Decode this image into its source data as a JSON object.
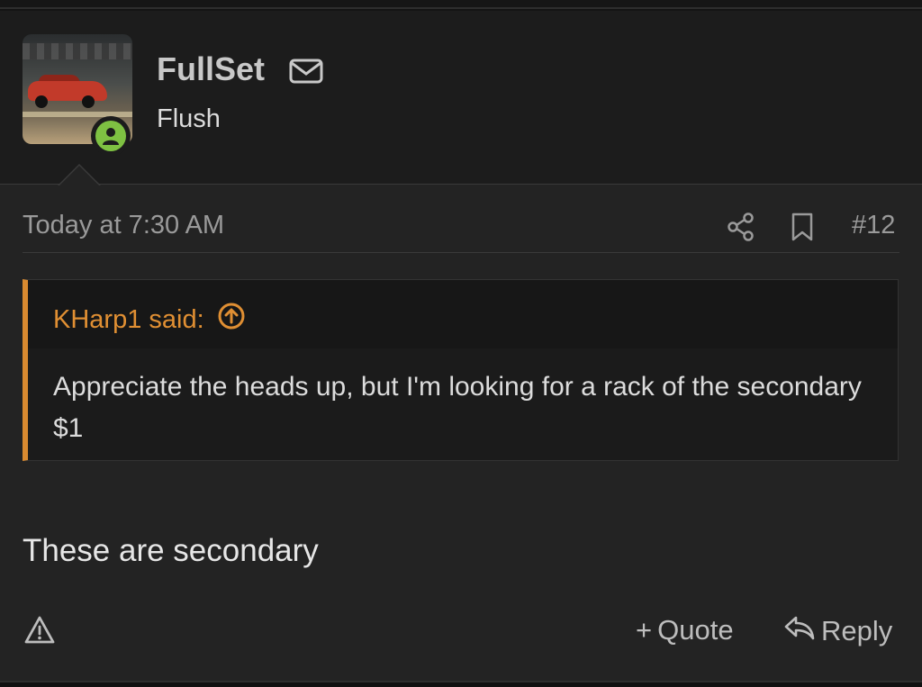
{
  "post": {
    "author": {
      "username": "FullSet",
      "user_title": "Flush",
      "avatar_icon": "avatar-race-car-image",
      "online_status_icon": "user-online-icon",
      "message_icon": "envelope-icon"
    },
    "date": "Today at 7:30 AM",
    "post_number": "#12",
    "quote": {
      "attribution": "KHarp1 said:",
      "text": "Appreciate the heads up, but I'm looking for a rack of the secondary $1"
    },
    "message": "These are secondary",
    "actions": {
      "quote_label": "Quote",
      "quote_prefix": "+",
      "reply_label": "Reply"
    }
  },
  "colors": {
    "background": "#232323",
    "header_background": "#1c1c1c",
    "quote_accent": "#d98a30",
    "online_green": "#7ec142",
    "muted_text": "#9a9a9a"
  }
}
